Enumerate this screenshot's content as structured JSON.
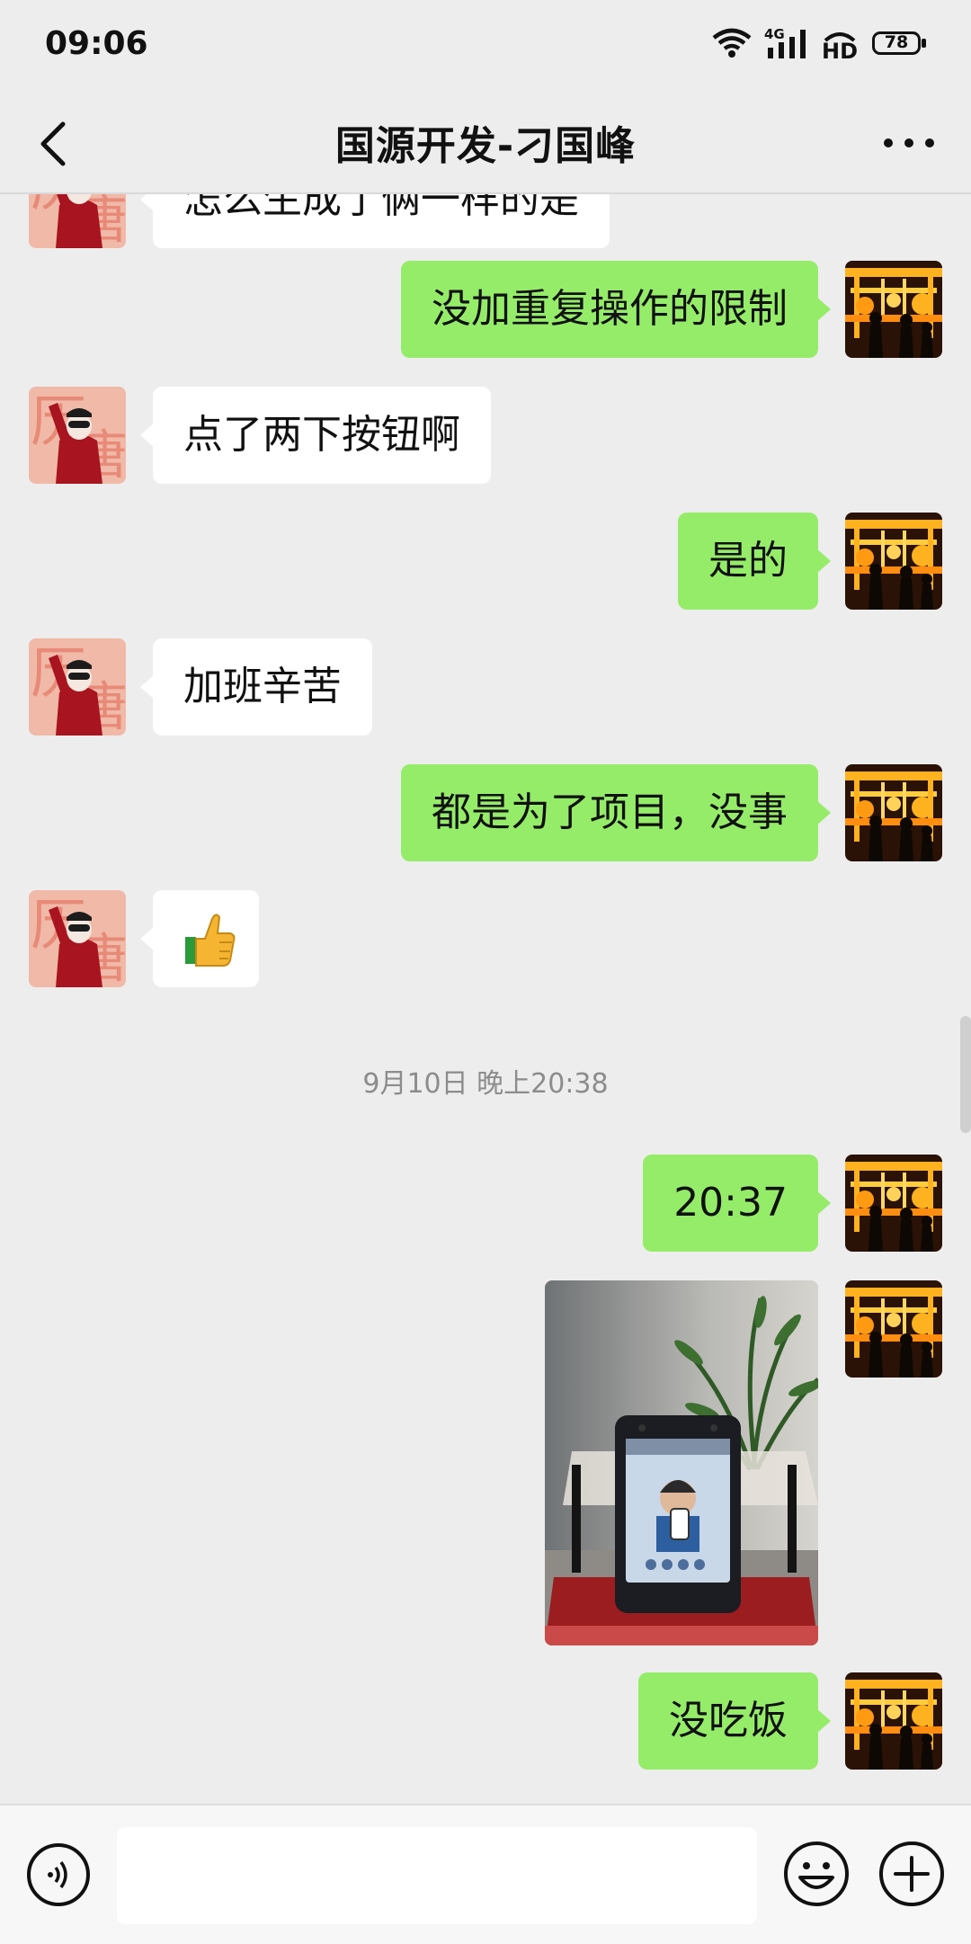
{
  "status_bar": {
    "time": "09:06",
    "network": "4G",
    "hd": "HD",
    "battery": "78",
    "icons": [
      "wifi-icon",
      "signal-icon",
      "hd-icon",
      "battery-icon"
    ]
  },
  "header": {
    "title": "国源开发-刁国峰",
    "back_icon": "chevron-left-icon",
    "more_icon": "more-icon"
  },
  "messages": [
    {
      "direction": "in",
      "type": "text",
      "text": "怎么生成了俩一样的是"
    },
    {
      "direction": "out",
      "type": "text",
      "text": "没加重复操作的限制"
    },
    {
      "direction": "in",
      "type": "text",
      "text": "点了两下按钮啊"
    },
    {
      "direction": "out",
      "type": "text",
      "text": "是的"
    },
    {
      "direction": "in",
      "type": "text",
      "text": "加班辛苦"
    },
    {
      "direction": "out",
      "type": "text",
      "text": "都是为了项目，没事"
    },
    {
      "direction": "in",
      "type": "emoji",
      "icon": "thumbs-up-icon"
    },
    {
      "direction": "out",
      "type": "text",
      "text": "20:37"
    },
    {
      "direction": "out",
      "type": "image",
      "icon": "photo-face-terminal"
    },
    {
      "direction": "out",
      "type": "text",
      "text": "没吃饭"
    }
  ],
  "timestamp_divider": "9月10日 晚上20:38",
  "input_bar": {
    "voice_icon": "voice-icon",
    "text_value": "",
    "emoji_icon": "emoji-icon",
    "plus_icon": "plus-icon"
  },
  "colors": {
    "background": "#ededed",
    "outgoing_bubble": "#95ec69",
    "incoming_bubble": "#ffffff",
    "timestamp_text": "#8c8c8c"
  }
}
